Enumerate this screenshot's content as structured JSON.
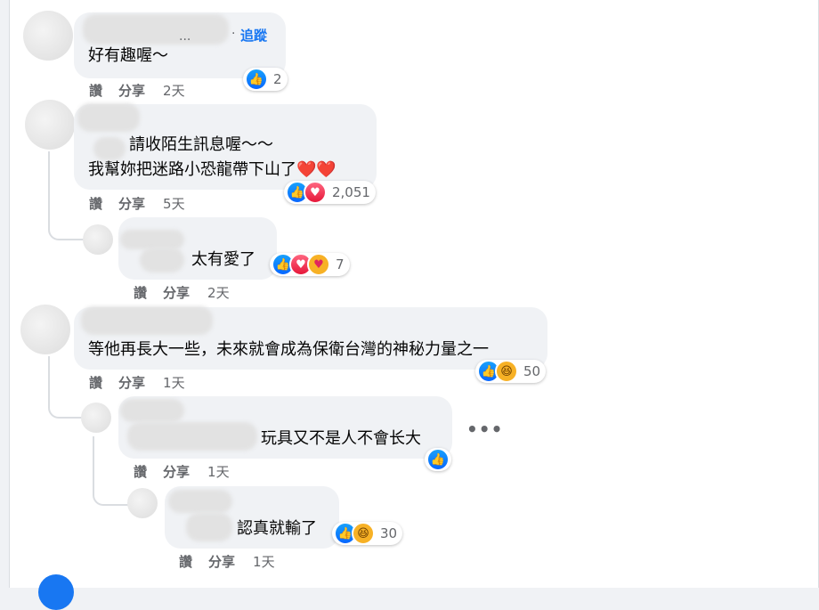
{
  "labels": {
    "like": "讚",
    "share": "分享"
  },
  "comments": [
    {
      "text": "好有趣喔～",
      "follow": "追蹤",
      "follow_dot": "·",
      "name_ellipsis": "...",
      "time": "2天",
      "reactions": {
        "types": [
          "like"
        ],
        "count": "2"
      }
    },
    {
      "text_line1": "請收陌生訊息喔～～",
      "text_line2": "我幫妳把迷路小恐龍帶下山了",
      "hearts": "❤️❤️",
      "time": "5天",
      "reactions": {
        "types": [
          "like",
          "love"
        ],
        "count": "2,051"
      },
      "replies": [
        {
          "text": "太有愛了",
          "time": "2天",
          "reactions": {
            "types": [
              "like",
              "love",
              "care"
            ],
            "count": "7"
          }
        }
      ]
    },
    {
      "text": "等他再長大一些，未來就會成為保衛台灣的神秘力量之一",
      "time": "1天",
      "reactions": {
        "types": [
          "like",
          "haha"
        ],
        "count": "50"
      },
      "replies": [
        {
          "text": "玩具又不是人不會长大",
          "time": "1天",
          "more": "•••",
          "reactions": {
            "types": [
              "like"
            ]
          }
        },
        {
          "text": "認真就輸了",
          "time": "1天",
          "reactions": {
            "types": [
              "like",
              "haha"
            ],
            "count": "30"
          }
        }
      ]
    }
  ],
  "icons": {
    "like": "like-icon",
    "love": "love-icon",
    "care": "care-icon",
    "haha": "haha-icon",
    "more": "more-options-icon"
  },
  "colors": {
    "link": "#1877f2",
    "bubble": "#f0f2f5",
    "meta": "#65676b"
  }
}
